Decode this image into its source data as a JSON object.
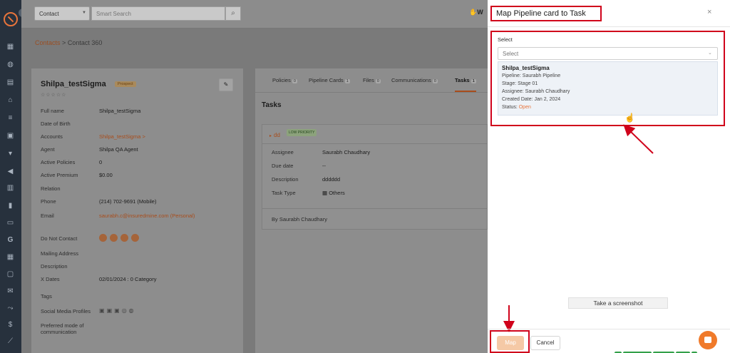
{
  "topbar": {
    "contact_select": "Contact",
    "search_placeholder": "Smart Search",
    "right_text": "W"
  },
  "breadcrumb": {
    "link": "Contacts",
    "separator": ">",
    "current": "Contact 360"
  },
  "contact": {
    "name": "Shilpa_testSigma",
    "badge": "Prospect",
    "stars": "☆☆☆☆☆",
    "fields": [
      {
        "label": "Full name",
        "value": "Shilpa_testSigma"
      },
      {
        "label": "Date of Birth",
        "value": ""
      },
      {
        "label": "Accounts",
        "value": "Shilpa_testSigma >"
      },
      {
        "label": "Agent",
        "value": "Shilpa QA Agent"
      },
      {
        "label": "Active Policies",
        "value": "0"
      },
      {
        "label": "Active Premium",
        "value": "$0.00"
      },
      {
        "label": "Relation",
        "value": ""
      },
      {
        "label": "Phone",
        "value": "(214) 702-9691 (Mobile)"
      },
      {
        "label": "Email",
        "value": "saurabh.c@insuredmine.com  (Personal)"
      },
      {
        "label": "Do Not Contact",
        "value": ""
      },
      {
        "label": "Mailing Address",
        "value": ""
      },
      {
        "label": "Description",
        "value": ""
      },
      {
        "label": "X Dates",
        "value": "02/01/2024 : 0 Category"
      },
      {
        "label": "Tags",
        "value": ""
      },
      {
        "label": "Social Media Profiles",
        "value": ""
      },
      {
        "label": "Preferred mode of communication",
        "value": ""
      }
    ]
  },
  "tabs": [
    {
      "label": "Policies",
      "count": "0"
    },
    {
      "label": "Pipeline Cards",
      "count": "1"
    },
    {
      "label": "Files",
      "count": "0"
    },
    {
      "label": "Communications",
      "count": "0"
    },
    {
      "label": "Tasks",
      "count": "1"
    }
  ],
  "tasks": {
    "title": "Tasks",
    "task_name": "dd",
    "priority": "LOW PRIORITY",
    "rows": [
      {
        "label": "Assignee",
        "value": "Saurabh Chaudhary"
      },
      {
        "label": "Due date",
        "value": "--"
      },
      {
        "label": "Description",
        "value": "dddddd"
      },
      {
        "label": "Task Type",
        "value": "Others"
      }
    ],
    "by": "By Saurabh Chaudhary"
  },
  "modal": {
    "title": "Map Pipeline card to Task",
    "close": "×",
    "select_label": "Select",
    "select_placeholder": "Select",
    "option": {
      "name": "Shilpa_testSigma",
      "pipeline": "Pipeline: Saurabh Pipeline",
      "stage": "Stage: Stage 01",
      "assignee": "Assignee:  Saurabh Chaudhary",
      "created": "Created Date: Jan 2, 2024",
      "status_label": "Status: ",
      "status_value": "Open"
    },
    "screenshot_button": "Take a screenshot",
    "map_button": "Map",
    "cancel_button": "Cancel"
  },
  "colors": {
    "accent": "#e8743b",
    "highlight": "#d0021b",
    "nav": "#27313d"
  }
}
